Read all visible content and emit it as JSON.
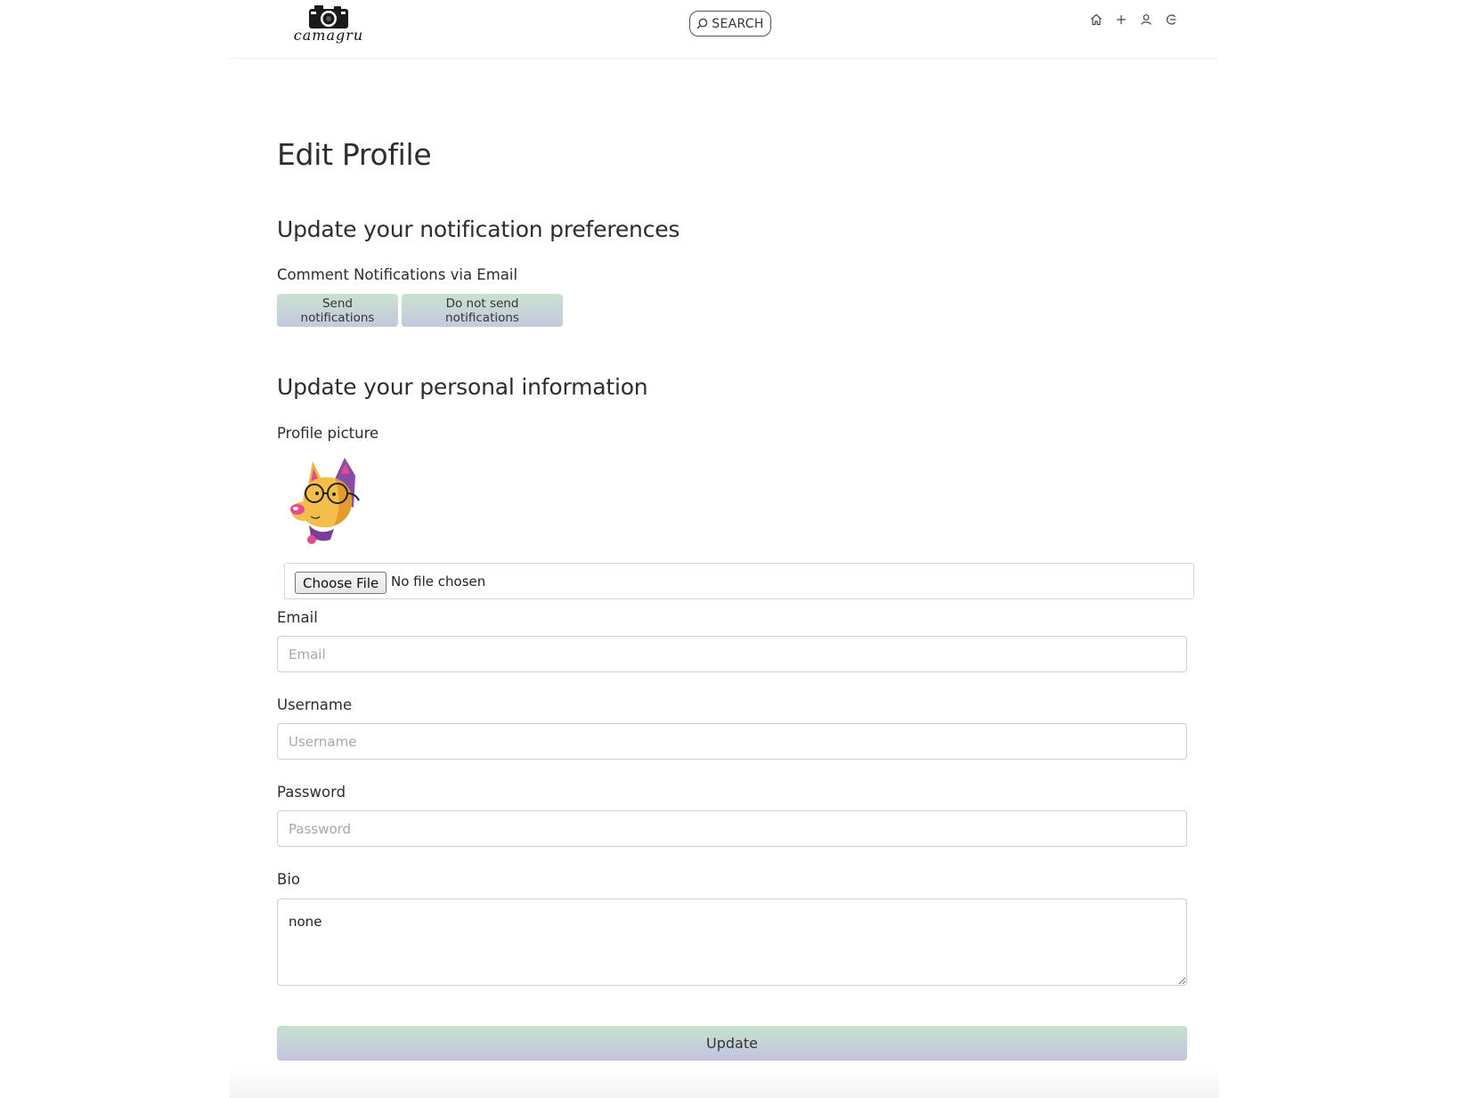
{
  "nav": {
    "logo_text": "camagru",
    "search_label": "SEARCH",
    "icons": [
      "home-icon",
      "plus-icon",
      "user-icon",
      "logout-icon"
    ]
  },
  "main": {
    "title": "Edit Profile",
    "notifications": {
      "heading": "Update your notification preferences",
      "label": "Comment Notifications via Email",
      "send_label": "Send notifications",
      "no_send_label": "Do not send notifications"
    },
    "personal": {
      "heading": "Update your personal information",
      "picture_label": "Profile picture",
      "choose_file_label": "Choose File",
      "file_status": "No file chosen",
      "email_label": "Email",
      "email_placeholder": "Email",
      "username_label": "Username",
      "username_placeholder": "Username",
      "password_label": "Password",
      "password_placeholder": "Password",
      "bio_label": "Bio",
      "bio_value": "none",
      "update_label": "Update"
    }
  },
  "colors": {
    "button_gradient_top": "#c9e2cf",
    "button_gradient_bottom": "#c5c8e0",
    "text": "#2d2d2d"
  }
}
